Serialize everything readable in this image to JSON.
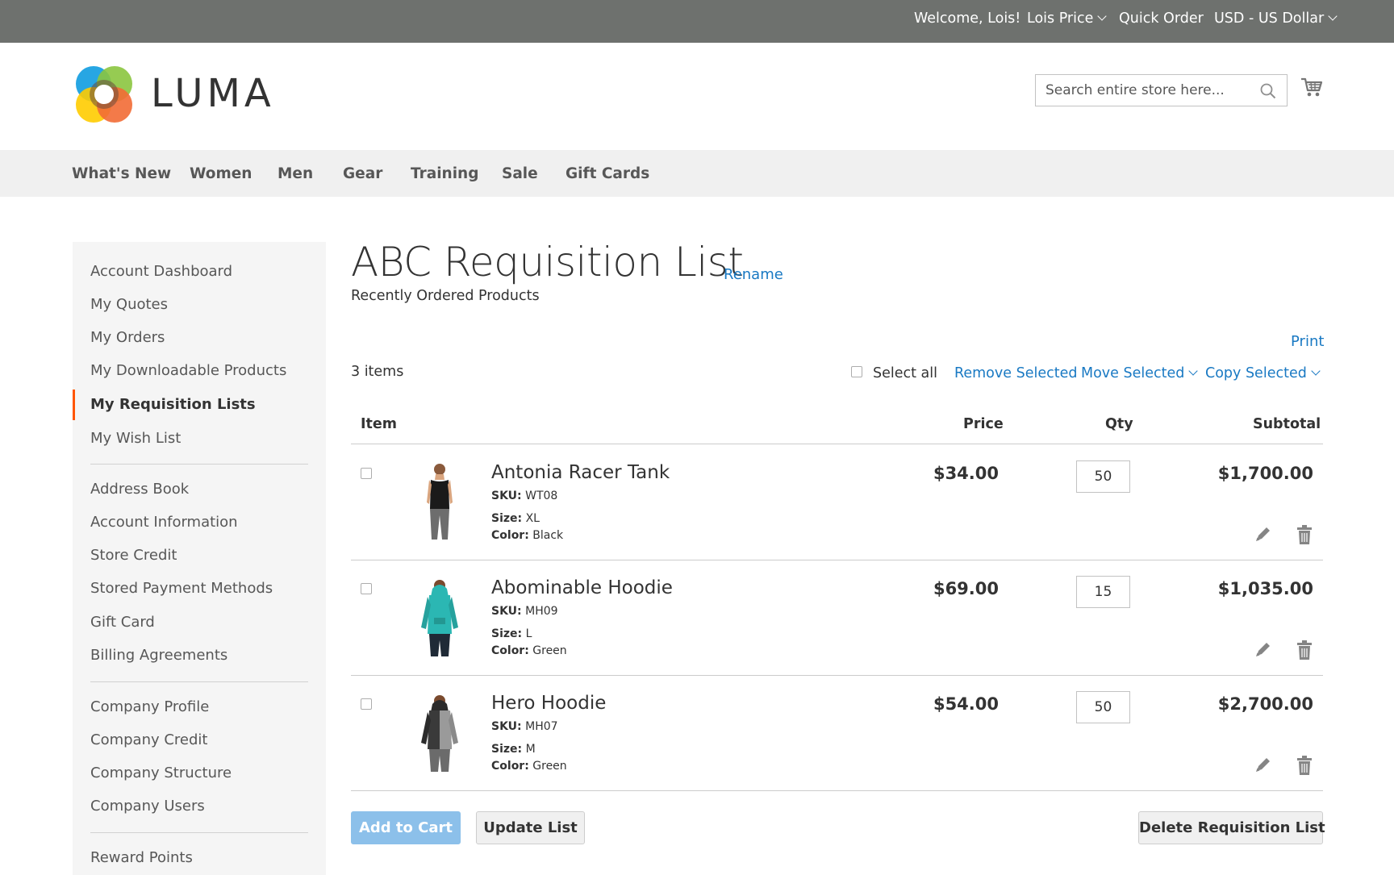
{
  "topbar": {
    "welcome": "Welcome, Lois!",
    "account": "Lois Price",
    "quick_order": "Quick Order",
    "currency": "USD - US Dollar"
  },
  "header": {
    "logo_text": "LUMA",
    "search_placeholder": "Search entire store here...",
    "search_value": ""
  },
  "nav": {
    "items": [
      "What's New",
      "Women",
      "Men",
      "Gear",
      "Training",
      "Sale",
      "Gift Cards"
    ]
  },
  "sidebar": {
    "items": [
      "Account Dashboard",
      "My Quotes",
      "My Orders",
      "My Downloadable Products",
      "My Requisition Lists",
      "My Wish List",
      "Address Book",
      "Account Information",
      "Store Credit",
      "Stored Payment Methods",
      "Gift Card",
      "Billing Agreements",
      "Company Profile",
      "Company Credit",
      "Company Structure",
      "Company Users",
      "Reward Points"
    ],
    "active": "My Requisition Lists"
  },
  "main": {
    "title": "ABC Requisition List",
    "rename": "Rename",
    "subtitle": "Recently Ordered Products",
    "print": "Print",
    "items_count": "3 items",
    "select_all": "Select all",
    "remove_selected": "Remove Selected",
    "move_selected": "Move Selected",
    "copy_selected": "Copy Selected",
    "columns": {
      "item": "Item",
      "price": "Price",
      "qty": "Qty",
      "subtotal": "Subtotal"
    },
    "rows": [
      {
        "name": "Antonia Racer Tank",
        "sku_label": "SKU:",
        "sku": "WT08",
        "size_label": "Size:",
        "size": "XL",
        "color_label": "Color:",
        "color": "Black",
        "price": "$34.00",
        "qty": "50",
        "subtotal": "$1,700.00"
      },
      {
        "name": "Abominable Hoodie",
        "sku_label": "SKU:",
        "sku": "MH09",
        "size_label": "Size:",
        "size": "L",
        "color_label": "Color:",
        "color": "Green",
        "price": "$69.00",
        "qty": "15",
        "subtotal": "$1,035.00"
      },
      {
        "name": "Hero Hoodie",
        "sku_label": "SKU:",
        "sku": "MH07",
        "size_label": "Size:",
        "size": "M",
        "color_label": "Color:",
        "color": "Green",
        "price": "$54.00",
        "qty": "50",
        "subtotal": "$2,700.00"
      }
    ],
    "buttons": {
      "add_to_cart": "Add to Cart",
      "update_list": "Update List",
      "delete_list": "Delete Requisition List"
    }
  },
  "colors": {
    "topbar_bg": "#6e716e",
    "link": "#1979c3",
    "active_marker": "#ff5501",
    "primary_button": "#8cc0ea",
    "nav_bg": "#f0f0f0",
    "sidebar_bg": "#f5f5f5"
  },
  "icons": [
    "chevron-down-icon",
    "search-icon",
    "cart-icon",
    "edit-icon",
    "trash-icon"
  ]
}
